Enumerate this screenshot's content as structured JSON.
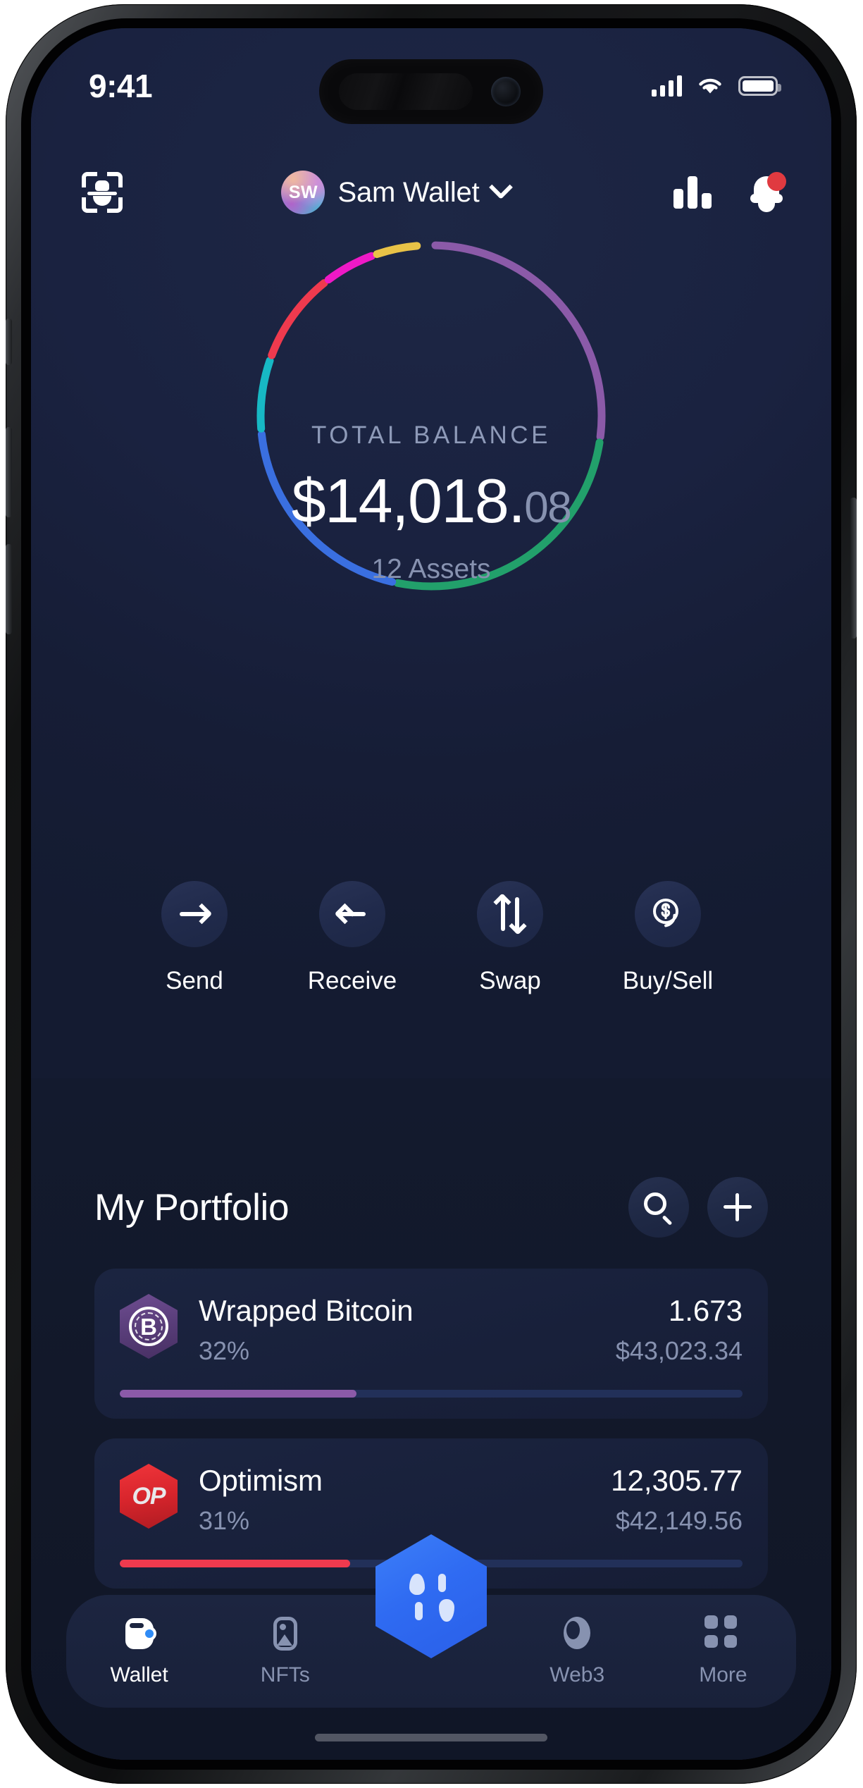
{
  "status_bar": {
    "time": "9:41",
    "signal_icon": "signal-bars-icon",
    "wifi_icon": "wifi-icon",
    "battery_icon": "battery-full-icon"
  },
  "header": {
    "scan_icon": "face-scan-icon",
    "avatar_initials": "SW",
    "wallet_name": "Sam Wallet",
    "chevron_icon": "chevron-down-icon",
    "chart_icon": "bar-chart-icon",
    "bell_icon": "notification-bell-icon",
    "badge_color": "#e03a40"
  },
  "balance": {
    "label": "TOTAL BALANCE",
    "amount_main": "$14,018.",
    "amount_cents": "08",
    "assets_count": "12 Assets"
  },
  "donut": {
    "segments": [
      {
        "name": "purple",
        "color": "#8b5aa8",
        "percent": 27
      },
      {
        "name": "green",
        "color": "#22a06b",
        "percent": 26
      },
      {
        "name": "blue",
        "color": "#3a6fe0",
        "percent": 20
      },
      {
        "name": "teal",
        "color": "#17b8c4",
        "percent": 7
      },
      {
        "name": "red",
        "color": "#ef3a4e",
        "percent": 9
      },
      {
        "name": "magenta",
        "color": "#ee19c6",
        "percent": 5
      },
      {
        "name": "yellow",
        "color": "#e8c247",
        "percent": 4
      }
    ]
  },
  "actions": [
    {
      "label": "Send",
      "icon": "arrow-right-icon"
    },
    {
      "label": "Receive",
      "icon": "arrow-left-icon"
    },
    {
      "label": "Swap",
      "icon": "swap-vertical-icon"
    },
    {
      "label": "Buy/Sell",
      "icon": "dollar-coins-icon"
    }
  ],
  "portfolio": {
    "title": "My Portfolio",
    "search_icon": "search-icon",
    "add_icon": "plus-icon",
    "assets": [
      {
        "name": "Wrapped Bitcoin",
        "symbol": "B",
        "percent": "32%",
        "percent_value": 32,
        "amount": "1.673",
        "value": "$43,023.34",
        "bar_color": "#8b5aa8",
        "icon": "wrapped-bitcoin-icon"
      },
      {
        "name": "Optimism",
        "symbol": "OP",
        "percent": "31%",
        "percent_value": 31,
        "amount": "12,305.77",
        "value": "$42,149.56",
        "bar_color": "#ef3a4e",
        "icon": "optimism-icon"
      }
    ]
  },
  "tabbar": {
    "items": [
      {
        "label": "Wallet",
        "icon": "wallet-icon",
        "active": true
      },
      {
        "label": "NFTs",
        "icon": "image-frame-icon",
        "active": false
      },
      {
        "label": "Web3",
        "icon": "globe-icon",
        "active": false
      },
      {
        "label": "More",
        "icon": "grid-squares-icon",
        "active": false
      }
    ],
    "fab_icon": "hexagon-drops-icon",
    "fab_color": "#2f6bf2"
  }
}
